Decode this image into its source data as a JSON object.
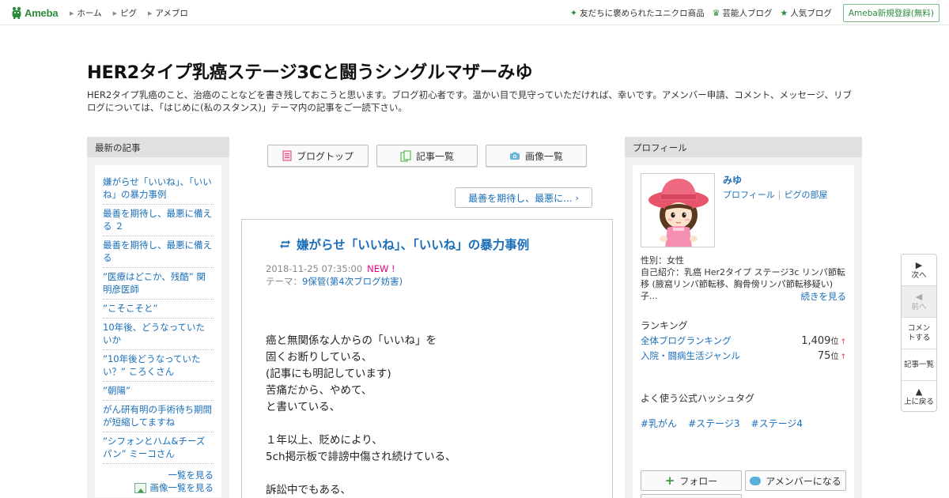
{
  "topbar": {
    "logo": "Ameba",
    "nav": [
      "ホーム",
      "ピグ",
      "アメブロ"
    ],
    "right_links": [
      {
        "icon": "sparkle-icon",
        "label": "友だちに褒められたユニクロ商品"
      },
      {
        "icon": "crown-icon",
        "label": "芸能人ブログ"
      },
      {
        "icon": "star-icon",
        "label": "人気ブログ"
      }
    ],
    "signup": "Ameba新規登録(無料)"
  },
  "blog": {
    "title": "HER2タイプ乳癌ステージ3Cと闘うシングルマザーみゆ",
    "description": "HER2タイプ乳癌のこと、治癌のことなどを書き残しておこうと思います。ブログ初心者です。温かい目で見守っていただければ、幸いです。アメンバー申請、コメント、メッセージ、リブログについては、「はじめに(私のスタンス)」テーマ内の記事をご一読下さい。"
  },
  "left_sidebar": {
    "heading": "最新の記事",
    "items": [
      "嫌がらせ「いいね」、「いいね」の暴力事例",
      "最善を期待し、最悪に備える ２",
      "最善を期待し、最悪に備える",
      "”医療はどこか、残酷” 関明彦医師",
      "”こそこそと”",
      "10年後、どうなっていたいか",
      "”10年後どうなっていたい？” ころくさん",
      "”朝陽”",
      "がん研有明の手術待ち期間が短縮してますね",
      "”シフォンとハム&チーズパン” ミーコさん"
    ],
    "more_list": "一覧を見る",
    "more_images": "画像一覧を見る"
  },
  "center": {
    "tabs": [
      {
        "icon": "document-icon",
        "label": "ブログトップ"
      },
      {
        "icon": "copy-icon",
        "label": "記事一覧"
      },
      {
        "icon": "camera-icon",
        "label": "画像一覧"
      }
    ],
    "next_entry": "最善を期待し、最悪に...",
    "article": {
      "title": "嫌がらせ「いいね」、「いいね」の暴力事例",
      "datetime": "2018-11-25 07:35:00",
      "new_badge": "NEW !",
      "theme_label": "テーマ：",
      "theme": "9保管(第4次ブログ妨害)",
      "body": [
        "癌と無関係な人からの「いいね」を",
        "固くお断りしている、",
        "(記事にも明記しています)",
        "苦痛だから、やめて、",
        "と書いている、",
        "",
        "１年以上、貶めにより、",
        "5ch掲示板で誹謗中傷され続けている、",
        "",
        "訴訟中でもある、"
      ]
    }
  },
  "right_sidebar": {
    "heading": "プロフィール",
    "name": "みゆ",
    "links": [
      "プロフィール",
      "ピグの部屋"
    ],
    "gender": "性別：女性",
    "intro": "自己紹介：乳癌 Her2タイプ ステージ3c リンパ節転移 (腋窩リンパ節転移、胸骨傍リンパ節転移疑い) 子...",
    "read_more": "続きを見る",
    "ranking_heading": "ランキング",
    "rankings": [
      {
        "label": "全体ブログランキング",
        "value": "1,409",
        "unit": "位",
        "trend": "↑"
      },
      {
        "label": "入院・闘病生活ジャンル",
        "value": "75",
        "unit": "位",
        "trend": "↑"
      }
    ],
    "hashtag_heading": "よく使う公式ハッシュタグ",
    "hashtags": [
      "#乳がん",
      "#ステージ3",
      "#ステージ4"
    ],
    "follow": "フォロー",
    "member": "アメンバーになる"
  },
  "float_nav": [
    {
      "icon": "play-right-icon",
      "label": "次へ",
      "enabled": true
    },
    {
      "icon": "play-left-icon",
      "label": "前へ",
      "enabled": false
    },
    {
      "icon": "",
      "label": "コメントする",
      "enabled": true
    },
    {
      "icon": "",
      "label": "記事一覧",
      "enabled": true
    },
    {
      "icon": "triangle-up-icon",
      "label": "上に戻る",
      "enabled": true
    }
  ],
  "colors": {
    "brand_green": "#2d8c3c",
    "link_blue": "#1a6eb9",
    "new_pink": "#e4007f",
    "sidebar_bg": "#f2f2f2",
    "sidebar_head": "#e0e0e0"
  }
}
